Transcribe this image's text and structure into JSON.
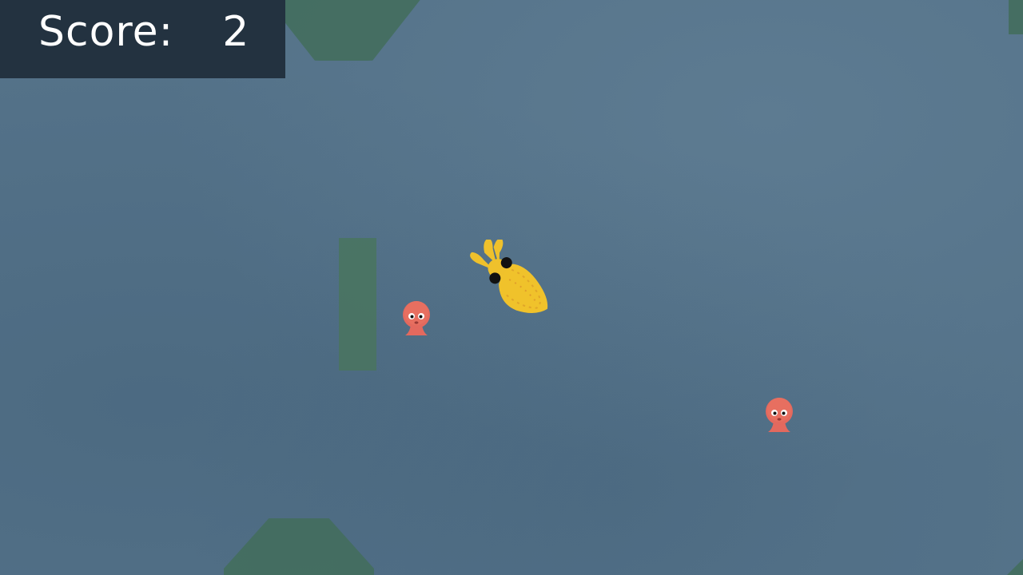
{
  "hud": {
    "score_label": "Score:",
    "score_value": "2"
  },
  "sprites": {
    "player": "yellow-squid-icon",
    "enemies": [
      "pink-octopus-icon",
      "pink-octopus-icon"
    ]
  },
  "colors": {
    "water": "#547289",
    "obstacle": "#436e5e",
    "hud_panel": "#233240",
    "squid": "#efc12c",
    "octopus": "#e3695e"
  }
}
